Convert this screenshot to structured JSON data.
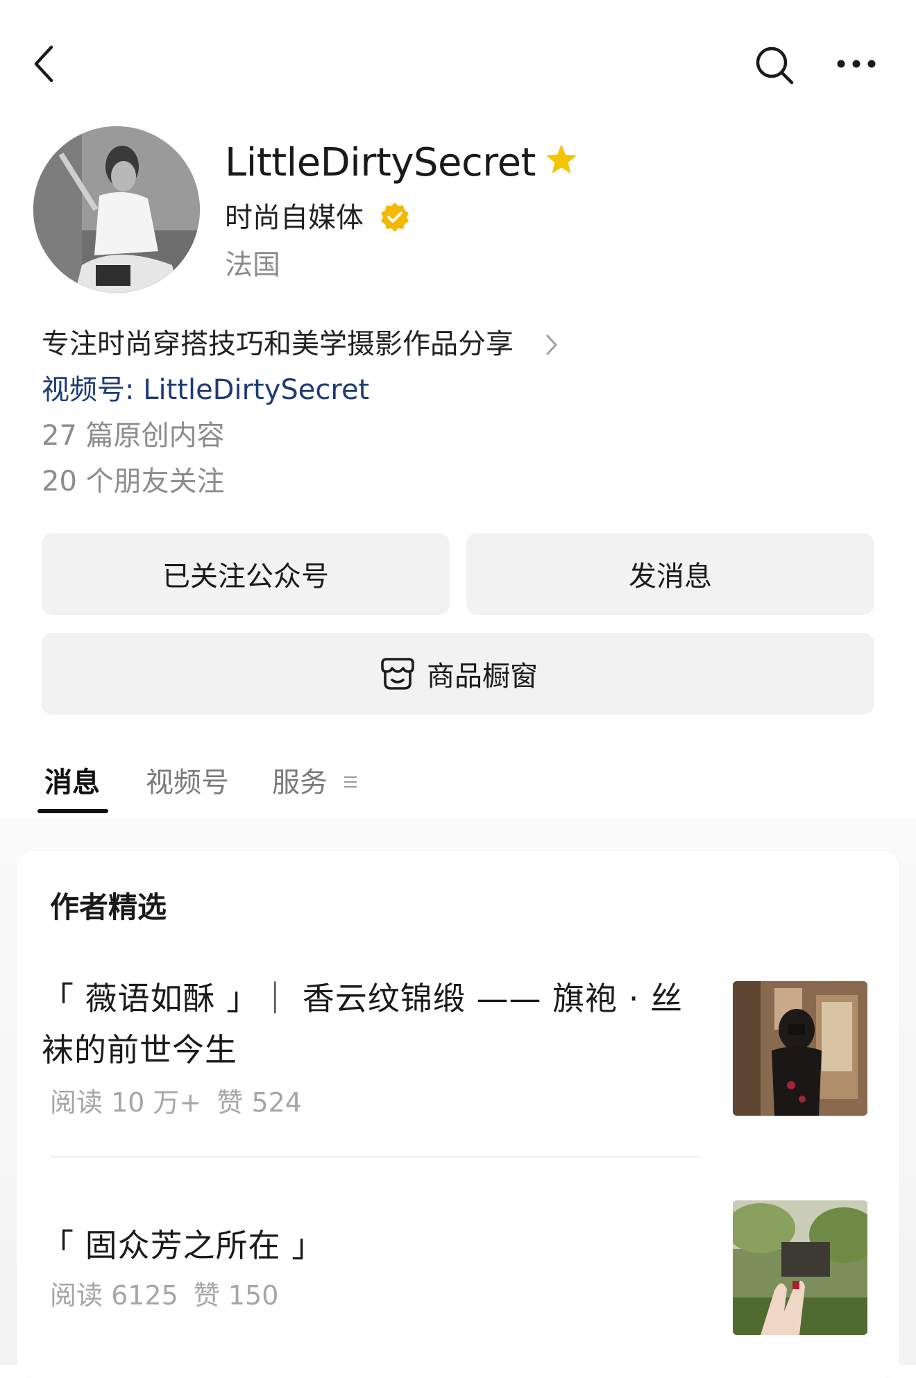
{
  "nav": {
    "back_icon": "chevron-left-icon",
    "search_icon": "search-icon",
    "more_icon": "more-dots-icon"
  },
  "profile": {
    "name": "LittleDirtySecret",
    "star_icon": "star-icon",
    "star_color": "#f5c400",
    "category": "时尚自媒体",
    "verified_icon": "verified-badge-icon",
    "verified_color": "#f5b800",
    "region": "法国",
    "description": "专注时尚穿搭技巧和美学摄影作品分享",
    "channel": "视频号: LittleDirtySecret",
    "channel_color": "#1e3a78",
    "original_count": "27 篇原创内容",
    "friends_following": "20 个朋友关注"
  },
  "buttons": {
    "followed": "已关注公众号",
    "message": "发消息",
    "shop": "商品橱窗",
    "shop_icon": "shop-icon"
  },
  "tabs": [
    {
      "label": "消息",
      "active": true
    },
    {
      "label": "视频号",
      "active": false
    },
    {
      "label": "服务",
      "active": false
    }
  ],
  "featured": {
    "title": "作者精选",
    "articles": [
      {
        "title": "「 薇语如酥 」｜ 香云纹锦缎 —— 旗袍 · 丝袜的前世今生",
        "reads": "阅读 10 万+",
        "likes": "赞 524"
      },
      {
        "title": "「  固众芳之所在  」",
        "reads": "阅读 6125",
        "likes": "赞 150"
      }
    ]
  }
}
